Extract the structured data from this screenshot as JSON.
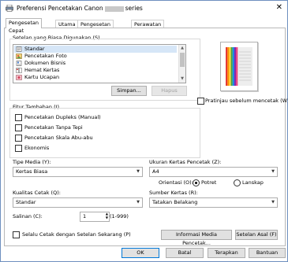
{
  "window": {
    "title_prefix": "Preferensi Pencetakan Canon",
    "title_suffix": "series",
    "close_glyph": "✕"
  },
  "tabs": [
    "Pengesetan Cepat",
    "Utama",
    "Pengesetan Halaman",
    "Perawatan"
  ],
  "common_settings": {
    "label": "Setelan yang Biasa Digunakan (S)",
    "items": [
      "Standar",
      "Pencetakan Foto",
      "Dokumen Bisnis",
      "Hemat Kertas",
      "Kartu Ucapan"
    ],
    "selected_index": 0,
    "save_button": "Simpan...",
    "delete_button": "Hapus"
  },
  "preview_checkbox": {
    "label": "Pratinjau sebelum mencetak (W)",
    "checked": false
  },
  "additional": {
    "label": "Fitur Tambahan (I)",
    "options": [
      {
        "label": "Pencetakan Dupleks (Manual)",
        "checked": false
      },
      {
        "label": "Pencetakan Tanpa Tepi",
        "checked": false
      },
      {
        "label": "Pencetakan Skala Abu-abu",
        "checked": false
      },
      {
        "label": "Ekonomis",
        "checked": false
      }
    ]
  },
  "media_type": {
    "label": "Tipe Media (Y):",
    "value": "Kertas Biasa"
  },
  "paper_size": {
    "label": "Ukuran Kertas Pencetak (Z):",
    "value": "A4"
  },
  "orientation": {
    "label": "Orientasi (O):",
    "portrait": "Potret",
    "landscape": "Lanskap",
    "selected": "portrait"
  },
  "quality": {
    "label": "Kualitas Cetak (Q):",
    "value": "Standar"
  },
  "source": {
    "label": "Sumber Kertas (R):",
    "value": "Tatakan Belakang"
  },
  "copies": {
    "label": "Salinan (C):",
    "value": "1",
    "range": "(1-999)"
  },
  "always_print": {
    "label": "Selalu Cetak dengan Setelan Sekarang (P)",
    "checked": false
  },
  "media_info_button": "Informasi Media Pencetak...",
  "defaults_button": "Setelan Asal (F)",
  "footer": {
    "ok": "OK",
    "cancel": "Batal",
    "apply": "Terapkan",
    "help": "Bantuan"
  }
}
